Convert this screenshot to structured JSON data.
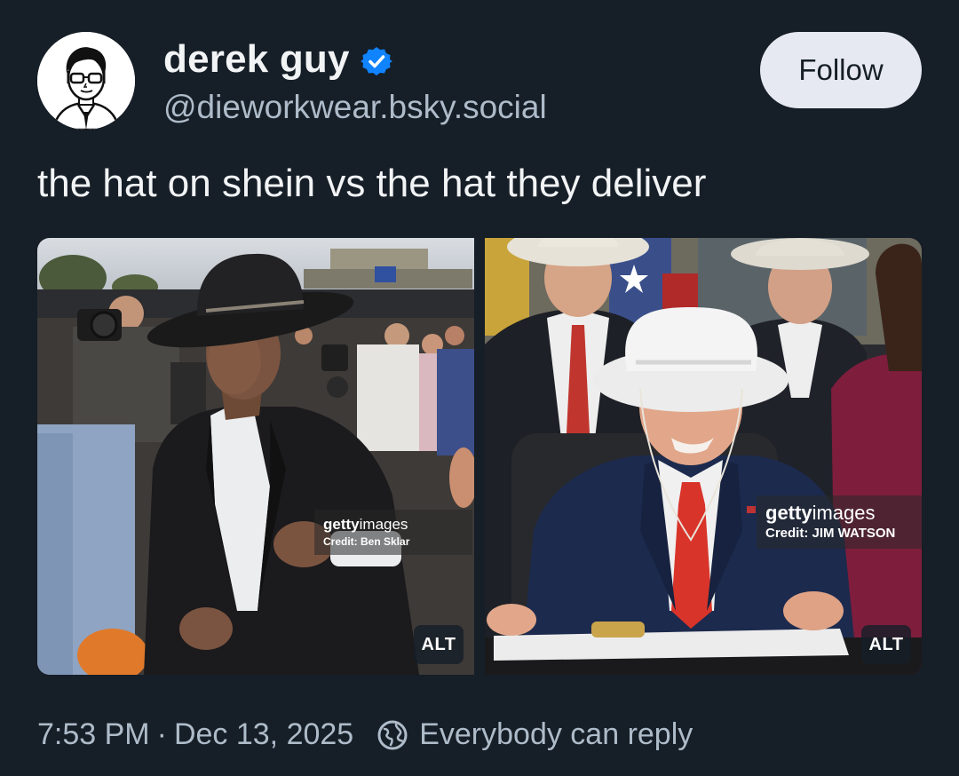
{
  "author": {
    "display_name": "derek guy",
    "handle": "@dieworkwear.bsky.social",
    "verified_icon": "verified-check-icon",
    "avatar_icon": "illustrated-avatar"
  },
  "follow_button": {
    "label": "Follow"
  },
  "post": {
    "text": "the hat on shein vs the hat they deliver"
  },
  "media": [
    {
      "watermark_brand_bold": "getty",
      "watermark_brand_light": "images",
      "watermark_credit": "Credit: Ben Sklar",
      "alt_label": "ALT"
    },
    {
      "watermark_brand_bold": "getty",
      "watermark_brand_light": "images",
      "watermark_credit": "Credit: JIM WATSON",
      "alt_label": "ALT"
    }
  ],
  "footer": {
    "time": "7:53 PM",
    "separator": "·",
    "date": "Dec 13, 2025",
    "reply_setting": "Everybody can reply",
    "reply_icon": "globe-icon"
  },
  "colors": {
    "background": "#161e27",
    "text_primary": "#f1f3f5",
    "text_secondary": "#aebbc9",
    "follow_bg": "#e6e9f1",
    "verified": "#1083fe"
  }
}
